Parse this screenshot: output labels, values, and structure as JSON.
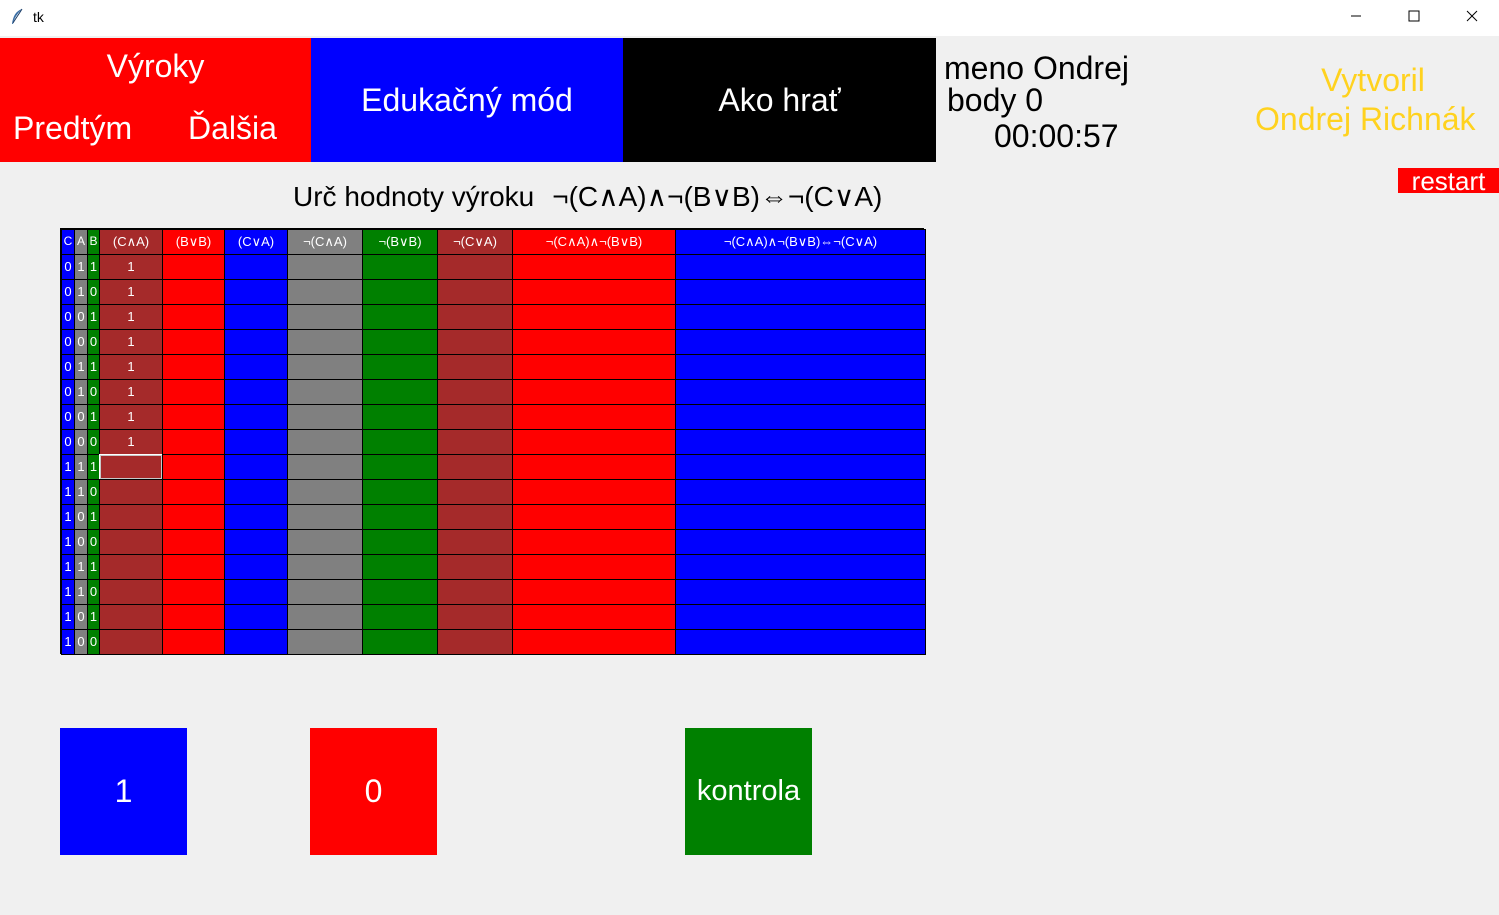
{
  "window": {
    "title": "tk"
  },
  "header": {
    "statements_label": "Výroky",
    "previous_label": "Predtým",
    "next_label": "Ďalšia",
    "education_mode_label": "Edukačný mód",
    "how_to_play_label": "Ako hrať",
    "name_line": "meno Ondrej",
    "points_line": "body 0",
    "timer": "00:00:57",
    "credit_line1": "Vytvoril",
    "credit_line2": "Ondrej Richnák"
  },
  "restart_label": "restart",
  "prompt": {
    "label": "Urč hodnoty výroku",
    "expression": "¬(C∧A)∧¬(B∨B)⇔¬(C∨A)"
  },
  "table": {
    "headers": [
      "C",
      "A",
      "B",
      "(C∧A)",
      "(B∨B)",
      "(C∨A)",
      "¬(C∧A)",
      "¬(B∨B)",
      "¬(C∨A)",
      "¬(C∧A)∧¬(B∨B)",
      "¬(C∧A)∧¬(B∨B)⇔¬(C∨A)"
    ],
    "column_colors": [
      "#0000ff",
      "#808080",
      "#008000",
      "#a52a2a",
      "#ff0000",
      "#0000ff",
      "#808080",
      "#008000",
      "#a52a2a",
      "#ff0000",
      "#0000ff"
    ],
    "rows": [
      [
        "0",
        "1",
        "1",
        "1",
        "",
        "",
        "",
        "",
        "",
        "",
        ""
      ],
      [
        "0",
        "1",
        "0",
        "1",
        "",
        "",
        "",
        "",
        "",
        "",
        ""
      ],
      [
        "0",
        "0",
        "1",
        "1",
        "",
        "",
        "",
        "",
        "",
        "",
        ""
      ],
      [
        "0",
        "0",
        "0",
        "1",
        "",
        "",
        "",
        "",
        "",
        "",
        ""
      ],
      [
        "0",
        "1",
        "1",
        "1",
        "",
        "",
        "",
        "",
        "",
        "",
        ""
      ],
      [
        "0",
        "1",
        "0",
        "1",
        "",
        "",
        "",
        "",
        "",
        "",
        ""
      ],
      [
        "0",
        "0",
        "1",
        "1",
        "",
        "",
        "",
        "",
        "",
        "",
        ""
      ],
      [
        "0",
        "0",
        "0",
        "1",
        "",
        "",
        "",
        "",
        "",
        "",
        ""
      ],
      [
        "1",
        "1",
        "1",
        "",
        "",
        "",
        "",
        "",
        "",
        "",
        ""
      ],
      [
        "1",
        "1",
        "0",
        "",
        "",
        "",
        "",
        "",
        "",
        "",
        ""
      ],
      [
        "1",
        "0",
        "1",
        "",
        "",
        "",
        "",
        "",
        "",
        "",
        ""
      ],
      [
        "1",
        "0",
        "0",
        "",
        "",
        "",
        "",
        "",
        "",
        "",
        ""
      ],
      [
        "1",
        "1",
        "1",
        "",
        "",
        "",
        "",
        "",
        "",
        "",
        ""
      ],
      [
        "1",
        "1",
        "0",
        "",
        "",
        "",
        "",
        "",
        "",
        "",
        ""
      ],
      [
        "1",
        "0",
        "1",
        "",
        "",
        "",
        "",
        "",
        "",
        "",
        ""
      ],
      [
        "1",
        "0",
        "0",
        "",
        "",
        "",
        "",
        "",
        "",
        "",
        ""
      ]
    ],
    "selected_cell": {
      "row": 8,
      "col": 3
    }
  },
  "buttons": {
    "one_label": "1",
    "zero_label": "0",
    "check_label": "kontrola"
  },
  "icons": {
    "app": "feather-icon",
    "minimize": "minimize-icon",
    "maximize": "maximize-icon",
    "close": "close-icon"
  }
}
